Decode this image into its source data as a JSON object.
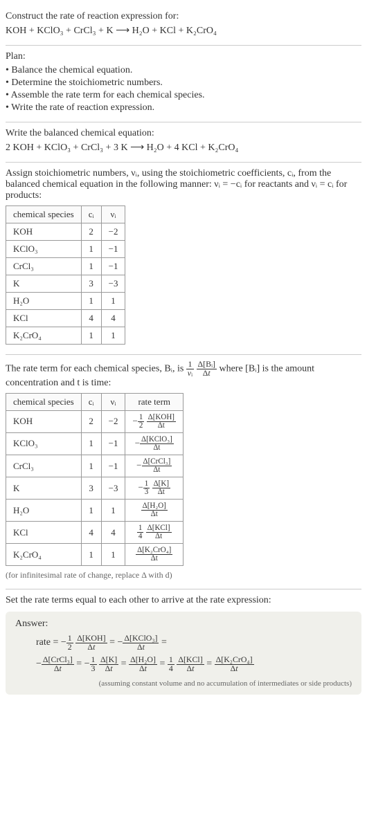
{
  "intro": {
    "prompt": "Construct the rate of reaction expression for:",
    "equation": "KOH + KClO₃ + CrCl₃ + K  ⟶  H₂O + KCl + K₂CrO₄"
  },
  "plan": {
    "heading": "Plan:",
    "items": [
      "Balance the chemical equation.",
      "Determine the stoichiometric numbers.",
      "Assemble the rate term for each chemical species.",
      "Write the rate of reaction expression."
    ]
  },
  "balanced": {
    "heading": "Write the balanced chemical equation:",
    "equation": "2 KOH + KClO₃ + CrCl₃ + 3 K  ⟶  H₂O + 4 KCl + K₂CrO₄"
  },
  "stoich": {
    "intro_a": "Assign stoichiometric numbers, νᵢ, using the stoichiometric coefficients, cᵢ, from the balanced chemical equation in the following manner: νᵢ = −cᵢ for reactants and νᵢ = cᵢ for products:",
    "headers": [
      "chemical species",
      "cᵢ",
      "νᵢ"
    ],
    "rows": [
      {
        "species": "KOH",
        "c": "2",
        "v": "−2"
      },
      {
        "species": "KClO₃",
        "c": "1",
        "v": "−1"
      },
      {
        "species": "CrCl₃",
        "c": "1",
        "v": "−1"
      },
      {
        "species": "K",
        "c": "3",
        "v": "−3"
      },
      {
        "species": "H₂O",
        "c": "1",
        "v": "1"
      },
      {
        "species": "KCl",
        "c": "4",
        "v": "4"
      },
      {
        "species": "K₂CrO₄",
        "c": "1",
        "v": "1"
      }
    ]
  },
  "rateterm": {
    "intro_pre": "The rate term for each chemical species, Bᵢ, is ",
    "intro_post": " where [Bᵢ] is the amount concentration and t is time:",
    "headers": [
      "chemical species",
      "cᵢ",
      "νᵢ",
      "rate term"
    ],
    "rows": [
      {
        "species": "KOH",
        "c": "2",
        "v": "−2",
        "rt_pre": "−",
        "rt_frac1_num": "1",
        "rt_frac1_den": "2",
        "rt_frac2_num": "Δ[KOH]",
        "rt_frac2_den": "Δt"
      },
      {
        "species": "KClO₃",
        "c": "1",
        "v": "−1",
        "rt_pre": "−",
        "rt_frac1_num": "",
        "rt_frac1_den": "",
        "rt_frac2_num": "Δ[KClO₃]",
        "rt_frac2_den": "Δt"
      },
      {
        "species": "CrCl₃",
        "c": "1",
        "v": "−1",
        "rt_pre": "−",
        "rt_frac1_num": "",
        "rt_frac1_den": "",
        "rt_frac2_num": "Δ[CrCl₃]",
        "rt_frac2_den": "Δt"
      },
      {
        "species": "K",
        "c": "3",
        "v": "−3",
        "rt_pre": "−",
        "rt_frac1_num": "1",
        "rt_frac1_den": "3",
        "rt_frac2_num": "Δ[K]",
        "rt_frac2_den": "Δt"
      },
      {
        "species": "H₂O",
        "c": "1",
        "v": "1",
        "rt_pre": "",
        "rt_frac1_num": "",
        "rt_frac1_den": "",
        "rt_frac2_num": "Δ[H₂O]",
        "rt_frac2_den": "Δt"
      },
      {
        "species": "KCl",
        "c": "4",
        "v": "4",
        "rt_pre": "",
        "rt_frac1_num": "1",
        "rt_frac1_den": "4",
        "rt_frac2_num": "Δ[KCl]",
        "rt_frac2_den": "Δt"
      },
      {
        "species": "K₂CrO₄",
        "c": "1",
        "v": "1",
        "rt_pre": "",
        "rt_frac1_num": "",
        "rt_frac1_den": "",
        "rt_frac2_num": "Δ[K₂CrO₄]",
        "rt_frac2_den": "Δt"
      }
    ],
    "note": "(for infinitesimal rate of change, replace Δ with d)"
  },
  "final": {
    "heading": "Set the rate terms equal to each other to arrive at the rate expression:",
    "answer_label": "Answer:",
    "answer_note": "(assuming constant volume and no accumulation of intermediates or side products)"
  }
}
